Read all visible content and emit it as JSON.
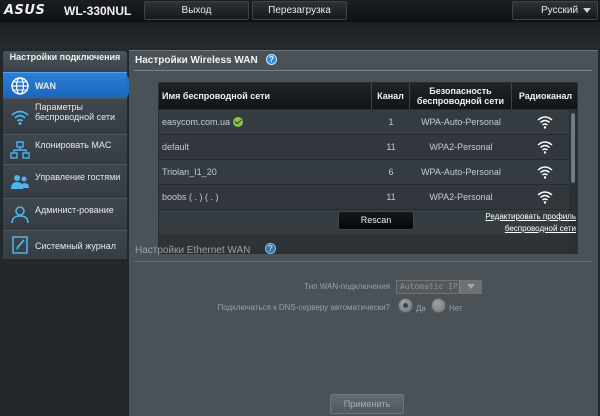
{
  "header": {
    "logo": "ASUS",
    "model": "WL-330NUL",
    "logout_label": "Выход",
    "reboot_label": "Перезагрузка",
    "language": "Русский"
  },
  "sidebar": {
    "header": "Настройки подключения",
    "items": [
      {
        "label": "WAN",
        "icon": "globe-icon",
        "active": true
      },
      {
        "label": "Параметры беспроводной сети",
        "icon": "wifi-icon"
      },
      {
        "label": "Клонировать MAC",
        "icon": "network-icon"
      },
      {
        "label": "Управление гостями",
        "icon": "users-icon"
      },
      {
        "label": "Админист-рование",
        "icon": "admin-icon"
      },
      {
        "label": "Системный журнал",
        "icon": "log-icon"
      }
    ]
  },
  "wireless_wan": {
    "title": "Настройки Wireless WAN",
    "columns": {
      "ssid": "Имя беспроводной сети",
      "channel": "Канал",
      "security": "Безопасность беспроводной сети",
      "signal": "Радиоканал"
    },
    "networks": [
      {
        "ssid": "easycom.com.ua",
        "channel": "1",
        "security": "WPA-Auto-Personal",
        "connected": true
      },
      {
        "ssid": "default",
        "channel": "11",
        "security": "WPA2-Personal"
      },
      {
        "ssid": "Triolan_I1_20",
        "channel": "6",
        "security": "WPA-Auto-Personal"
      },
      {
        "ssid": "boobs ( . ) ( . )",
        "channel": "11",
        "security": "WPA2-Personal"
      }
    ],
    "rescan_label": "Rescan",
    "edit_profile_link": "Редактировать профиль беспроводной сети"
  },
  "ethernet_wan": {
    "title": "Настройки Ethernet WAN",
    "wan_type_label": "Тип WAN-подключения",
    "wan_type_value": "Automatic IP",
    "dns_auto_label": "Подключаться к DNS-серверу автоматически?",
    "dns_yes": "Да",
    "dns_no": "Нет",
    "dns_selected": "yes"
  },
  "apply_label": "Применить"
}
